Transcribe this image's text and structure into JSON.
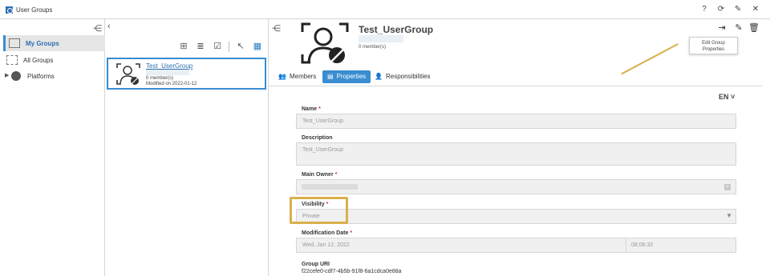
{
  "window": {
    "title": "User Groups"
  },
  "titlebar_icons": [
    "help-icon",
    "refresh-icon",
    "pin-icon",
    "close-icon"
  ],
  "nav": {
    "items": [
      {
        "label": "My Groups",
        "selected": true
      },
      {
        "label": "All Groups",
        "selected": false
      },
      {
        "label": "Platforms",
        "selected": false
      }
    ]
  },
  "list": {
    "card": {
      "name": "Test_UserGroup",
      "members": "0 member(s)",
      "modified": "Modified on 2022-01-12"
    }
  },
  "detail": {
    "title": "Test_UserGroup",
    "members": "0 member(s)",
    "tooltip_line1": "Edit Group",
    "tooltip_line2": "Properties",
    "tabs": [
      {
        "label": "Members",
        "active": false
      },
      {
        "label": "Properties",
        "active": true
      },
      {
        "label": "Responsibilities",
        "active": false
      }
    ],
    "language": "EN",
    "fields": {
      "name_label": "Name",
      "name_value": "Test_UserGroup",
      "description_label": "Description",
      "description_value": "Test_UserGroup",
      "owner_label": "Main Owner",
      "visibility_label": "Visibility",
      "visibility_value": "Private",
      "moddate_label": "Modification Date",
      "moddate_value": "Wed, Jan 12, 2022",
      "modtime_value": "08:06:32",
      "uri_label": "Group URI",
      "uri_value": "f22cefe0-cdf7-4b5b-91f8-6a1cdca0e88a"
    }
  },
  "colors": {
    "accent": "#3a8dd1",
    "highlight": "#d9b04b",
    "required": "#d43a3a"
  }
}
